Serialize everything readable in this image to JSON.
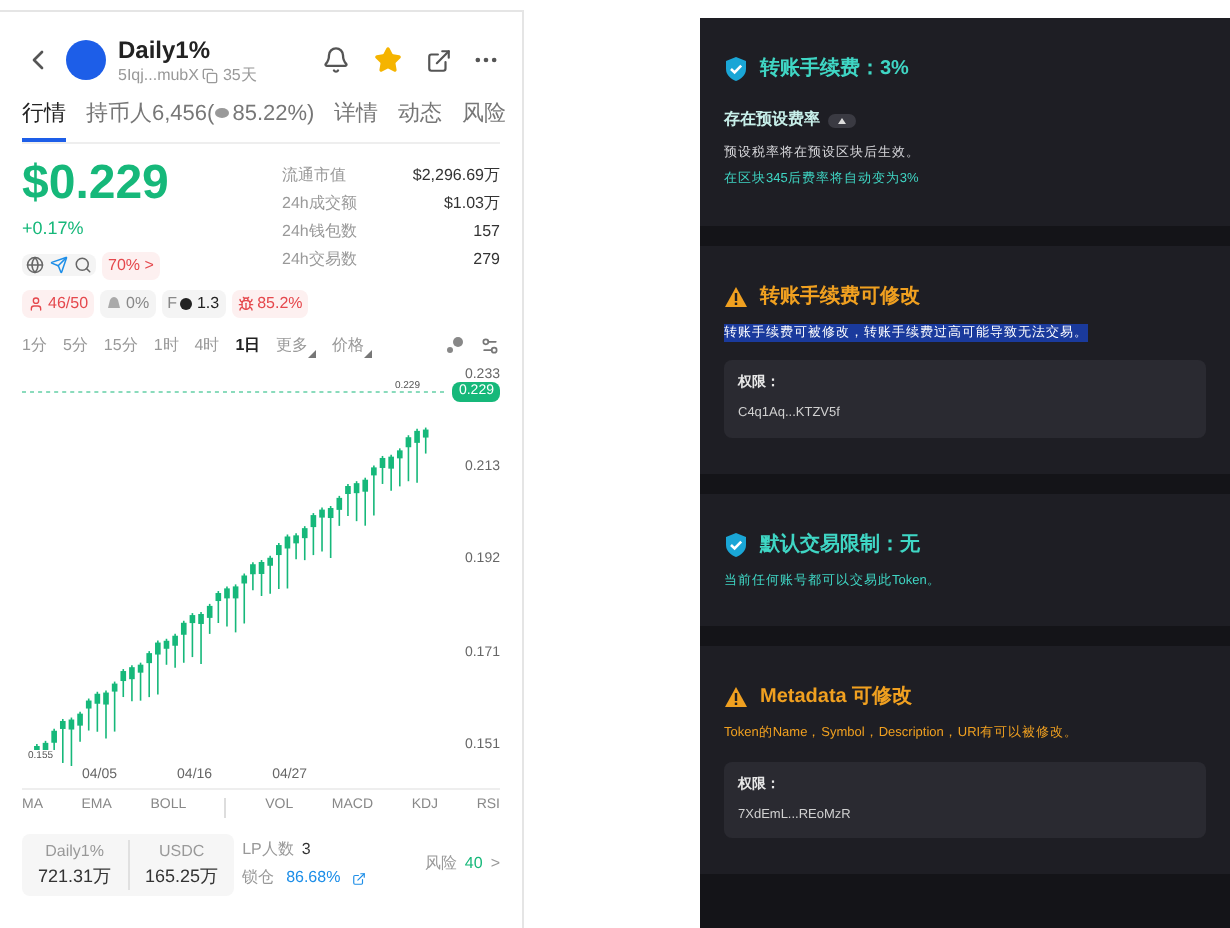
{
  "token": {
    "name": "Daily1%",
    "address": "5Iqj...mubX",
    "age": "35天",
    "starred": true
  },
  "tabs": [
    {
      "label": "行情",
      "selected": true
    },
    {
      "label": "持币人6,456(",
      "suffix": "85.22%)",
      "selected": false
    },
    {
      "label": "详情",
      "selected": false
    },
    {
      "label": "动态",
      "selected": false
    },
    {
      "label": "风险",
      "selected": false
    }
  ],
  "price": {
    "value": "$0.229",
    "change": "+0.17%"
  },
  "stats": [
    {
      "label": "流通市值",
      "value": "$2,296.69万"
    },
    {
      "label": "24h成交额",
      "value": "$1.03万"
    },
    {
      "label": "24h钱包数",
      "value": "157"
    },
    {
      "label": "24h交易数",
      "value": "279"
    }
  ],
  "social_badge": {
    "value": "70%",
    "arrow": ">"
  },
  "badges": [
    {
      "kind": "holders",
      "text": "46/50",
      "alert": true
    },
    {
      "kind": "hat",
      "text": "0%",
      "alert": false
    },
    {
      "kind": "f",
      "prefix": "F",
      "text": "1.3",
      "alert": false
    },
    {
      "kind": "bug",
      "text": "85.2%",
      "alert": true
    }
  ],
  "intervals": [
    {
      "label": "1分",
      "selected": false
    },
    {
      "label": "5分",
      "selected": false
    },
    {
      "label": "15分",
      "selected": false
    },
    {
      "label": "1时",
      "selected": false
    },
    {
      "label": "4时",
      "selected": false
    },
    {
      "label": "1日",
      "selected": true
    },
    {
      "label": "更多",
      "selected": false,
      "dropdown": true
    },
    {
      "label": "价格",
      "selected": false,
      "dropdown": true
    }
  ],
  "chart": {
    "y_labels": [
      "0.233",
      "0.213",
      "0.192",
      "0.171",
      "0.151"
    ],
    "x_labels": [
      "04/05",
      "04/16",
      "04/27"
    ],
    "last_price": "0.229",
    "high_mark": "0.229",
    "low_mark": "0.155"
  },
  "indicators_left": [
    "MA",
    "EMA",
    "BOLL"
  ],
  "indicators_right": [
    "VOL",
    "MACD",
    "KDJ",
    "RSI"
  ],
  "pool": [
    {
      "label": "Daily1%",
      "value": "721.31万"
    },
    {
      "label": "USDC",
      "value": "165.25万"
    }
  ],
  "lp": {
    "label": "LP人数",
    "value": "3"
  },
  "lock": {
    "label": "锁仓",
    "value": "86.68%"
  },
  "risk": {
    "label": "风险",
    "value": "40",
    "arrow": ">"
  },
  "checks": [
    {
      "kind": "safe",
      "title": "转账手续费：3%",
      "subtitle": "存在预设费率",
      "lines": [
        {
          "text": "预设税率将在预设区块后生效。",
          "kind": "plain",
          "highlighted": false
        },
        {
          "text": "在区块345后费率将自动变为3%",
          "kind": "safe",
          "highlighted": false
        }
      ]
    },
    {
      "kind": "warning",
      "title": "转账手续费可修改",
      "lines": [
        {
          "text": "转账手续费可被修改，转账手续费过高可能导致无法交易。",
          "kind": "plain",
          "highlighted": true
        }
      ],
      "authority": {
        "label": "权限：",
        "value": "C4q1Aq...KTZV5f"
      }
    },
    {
      "kind": "safe",
      "title": "默认交易限制：无",
      "lines": [
        {
          "text": "当前任何账号都可以交易此Token。",
          "kind": "safe",
          "highlighted": false
        }
      ]
    },
    {
      "kind": "warning",
      "title": "Metadata 可修改",
      "lines": [
        {
          "text": "Token的Name，Symbol，Description，URI有可以被修改。",
          "kind": "warning",
          "highlighted": false
        }
      ],
      "authority": {
        "label": "权限：",
        "value": "7XdEmL...REoMzR"
      }
    }
  ]
}
